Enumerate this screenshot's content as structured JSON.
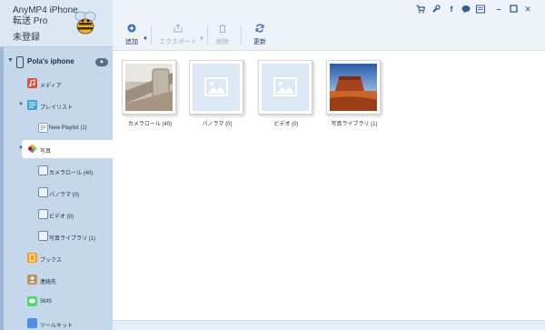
{
  "app": {
    "title_line1": "AnyMP4 iPhone",
    "title_line2": "転送 Pro",
    "status": "未登録"
  },
  "device": {
    "name": "Pola's iphone"
  },
  "sidebar": {
    "items": [
      {
        "label": "メディア",
        "icon": "music-icon"
      },
      {
        "label": "プレイリスト",
        "icon": "playlist-icon"
      },
      {
        "label": "New Playlist (1)",
        "icon": "new-playlist-icon"
      },
      {
        "label": "写真",
        "icon": "photos-icon"
      },
      {
        "label": "カメラロール (40)",
        "icon": "camera-roll-icon"
      },
      {
        "label": "パノラマ (0)",
        "icon": "panorama-icon"
      },
      {
        "label": "ビデオ (0)",
        "icon": "video-icon"
      },
      {
        "label": "写真ライブラリ (1)",
        "icon": "photo-library-icon"
      },
      {
        "label": "ブックス",
        "icon": "books-icon"
      },
      {
        "label": "連絡先",
        "icon": "contacts-icon"
      },
      {
        "label": "SMS",
        "icon": "sms-icon"
      },
      {
        "label": "ツールキット",
        "icon": "toolkit-icon"
      }
    ]
  },
  "toolbar": {
    "add": "追加",
    "export": "エクスポート",
    "delete": "削除",
    "refresh": "更新"
  },
  "albums": [
    {
      "label": "カメラロール (40)"
    },
    {
      "label": "パノラマ (0)"
    },
    {
      "label": "ビデオ (0)"
    },
    {
      "label": "写真ライブラリ (1)"
    }
  ],
  "window_controls": [
    "cart-icon",
    "wrench-icon",
    "facebook-icon",
    "chat-icon",
    "menu-icon",
    "minimize-icon",
    "maximize-icon",
    "close-icon"
  ],
  "colors": {
    "sidebar": "#c4d7eb",
    "accent": "#2d6fb5",
    "toolbar": "#eef3f9"
  }
}
